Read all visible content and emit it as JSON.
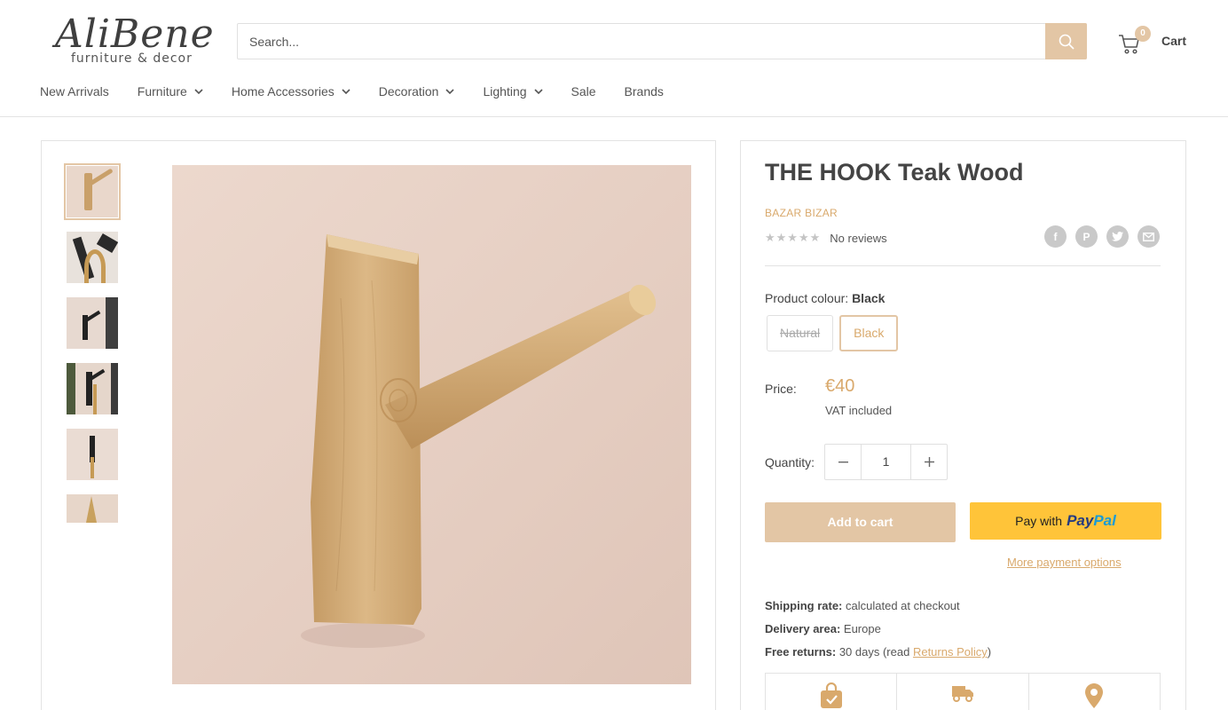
{
  "header": {
    "logo_main": "AliBene",
    "logo_sub": "furniture & decor",
    "search_placeholder": "Search...",
    "cart_label": "Cart",
    "cart_count": "0"
  },
  "nav": {
    "items": [
      {
        "label": "New Arrivals",
        "has_dropdown": false
      },
      {
        "label": "Furniture",
        "has_dropdown": true
      },
      {
        "label": "Home Accessories",
        "has_dropdown": true
      },
      {
        "label": "Decoration",
        "has_dropdown": true
      },
      {
        "label": "Lighting",
        "has_dropdown": true
      },
      {
        "label": "Sale",
        "has_dropdown": false
      },
      {
        "label": "Brands",
        "has_dropdown": false
      }
    ]
  },
  "product": {
    "title": "THE HOOK Teak Wood",
    "vendor": "BAZAR BIZAR",
    "stars": "★★★★★",
    "reviews": "No reviews",
    "colour_label": "Product colour:",
    "colour_selected": "Black",
    "colours": [
      {
        "label": "Natural",
        "state": "disabled"
      },
      {
        "label": "Black",
        "state": "selected"
      }
    ],
    "price_label": "Price:",
    "price": "€40",
    "vat": "VAT included",
    "quantity_label": "Quantity:",
    "quantity": "1",
    "add_to_cart": "Add to cart",
    "paypal_prefix": "Pay with",
    "paypal_brand_1": "Pay",
    "paypal_brand_2": "Pal",
    "more_payment": "More payment options",
    "shipping": {
      "rate_label": "Shipping rate:",
      "rate_value": "calculated at checkout",
      "area_label": "Delivery area:",
      "area_value": "Europe",
      "returns_label": "Free returns:",
      "returns_value": "30 days (read",
      "returns_link": "Returns Policy",
      "returns_close": ")"
    }
  },
  "share_icons": [
    "facebook-icon",
    "pinterest-icon",
    "twitter-icon",
    "email-icon"
  ],
  "feature_icons": [
    "shopping-bag-check-icon",
    "delivery-truck-icon",
    "location-pin-icon"
  ],
  "colors": {
    "accent": "#e3c6a5",
    "accent_text": "#d9a96c",
    "paypal_yellow": "#ffc439"
  }
}
